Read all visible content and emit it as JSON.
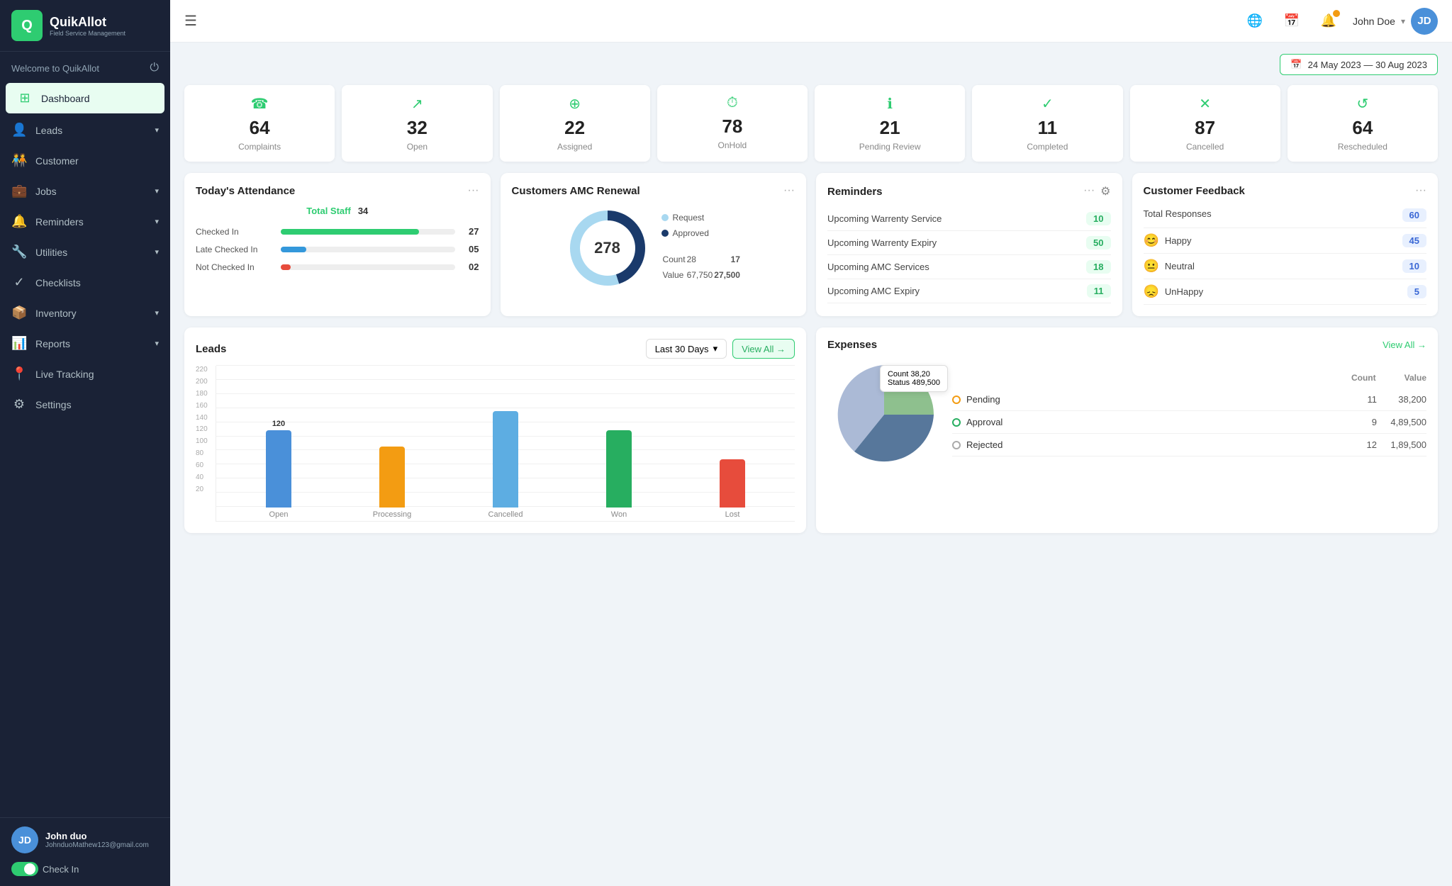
{
  "app": {
    "name": "QuikAllot",
    "tagline": "Field Service Management",
    "welcome": "Welcome to QuikAllot"
  },
  "topbar": {
    "menu_icon": "☰",
    "date_range": "24 May 2023 — 30 Aug 2023",
    "user_name": "John Doe"
  },
  "sidebar": {
    "items": [
      {
        "id": "dashboard",
        "label": "Dashboard",
        "icon": "⊞",
        "active": true
      },
      {
        "id": "leads",
        "label": "Leads",
        "icon": "👤",
        "has_arrow": true
      },
      {
        "id": "customer",
        "label": "Customer",
        "icon": "🧑‍🤝‍🧑",
        "has_arrow": false
      },
      {
        "id": "jobs",
        "label": "Jobs",
        "icon": "💼",
        "has_arrow": true
      },
      {
        "id": "reminders",
        "label": "Reminders",
        "icon": "🔔",
        "has_arrow": true
      },
      {
        "id": "utilities",
        "label": "Utilities",
        "icon": "🔧",
        "has_arrow": true
      },
      {
        "id": "checklists",
        "label": "Checklists",
        "icon": "✓",
        "has_arrow": false
      },
      {
        "id": "inventory",
        "label": "Inventory",
        "icon": "📦",
        "has_arrow": true
      },
      {
        "id": "reports",
        "label": "Reports",
        "icon": "📊",
        "has_arrow": true
      },
      {
        "id": "live-tracking",
        "label": "Live Tracking",
        "icon": "📍",
        "has_arrow": false
      },
      {
        "id": "settings",
        "label": "Settings",
        "icon": "⚙",
        "has_arrow": false
      }
    ],
    "user": {
      "name": "John duo",
      "email": "JohnduoMathew123@gmail.com",
      "check_in_label": "Check In"
    }
  },
  "stats": [
    {
      "id": "complaints",
      "icon": "☎",
      "number": "64",
      "label": "Complaints"
    },
    {
      "id": "open",
      "icon": "↗",
      "number": "32",
      "label": "Open"
    },
    {
      "id": "assigned",
      "icon": "⊕",
      "number": "22",
      "label": "Assigned"
    },
    {
      "id": "onhold",
      "icon": "⏱",
      "number": "78",
      "label": "OnHold"
    },
    {
      "id": "pending-review",
      "icon": "ℹ",
      "number": "21",
      "label": "Pending Review"
    },
    {
      "id": "completed",
      "icon": "✓",
      "number": "11",
      "label": "Completed"
    },
    {
      "id": "cancelled",
      "icon": "✕",
      "number": "87",
      "label": "Cancelled"
    },
    {
      "id": "rescheduled",
      "icon": "↺",
      "number": "64",
      "label": "Rescheduled"
    }
  ],
  "attendance": {
    "title": "Today's Attendance",
    "total_staff_label": "Total Staff",
    "total_staff": "34",
    "rows": [
      {
        "label": "Checked In",
        "value": 27,
        "max": 34,
        "display": "27",
        "color": "#2ecc71"
      },
      {
        "label": "Late Checked In",
        "value": 5,
        "max": 34,
        "display": "05",
        "color": "#3498db"
      },
      {
        "label": "Not Checked In",
        "value": 2,
        "max": 34,
        "display": "02",
        "color": "#e74c3c"
      }
    ]
  },
  "amc": {
    "title": "Customers AMC Renewal",
    "center_value": "278",
    "legend": [
      {
        "label": "Request",
        "color": "#a8d8f0"
      },
      {
        "label": "Approved",
        "color": "#1a3a6b"
      }
    ],
    "table": [
      {
        "label": "Count",
        "request": "28",
        "approved": "17"
      },
      {
        "label": "Value",
        "request": "67,750",
        "approved": "27,500"
      }
    ]
  },
  "reminders": {
    "title": "Reminders",
    "items": [
      {
        "label": "Upcoming Warrenty Service",
        "value": "10"
      },
      {
        "label": "Upcoming Warrenty Expiry",
        "value": "50"
      },
      {
        "label": "Upcoming AMC Services",
        "value": "18"
      },
      {
        "label": "Upcoming AMC Expiry",
        "value": "11"
      }
    ]
  },
  "feedback": {
    "title": "Customer Feedback",
    "total_responses_label": "Total Responses",
    "total_responses": "60",
    "items": [
      {
        "label": "Happy",
        "icon": "😊",
        "value": "45"
      },
      {
        "label": "Neutral",
        "icon": "😐",
        "value": "10"
      },
      {
        "label": "UnHappy",
        "icon": "😞",
        "value": "5"
      }
    ]
  },
  "leads_chart": {
    "title": "Leads",
    "filter_label": "Last 30 Days",
    "view_all_label": "View All →",
    "y_axis": [
      "20",
      "40",
      "60",
      "80",
      "100",
      "120",
      "140",
      "160",
      "180",
      "200",
      "220"
    ],
    "bars": [
      {
        "label": "Open",
        "value": 120,
        "color": "#4a90d9",
        "tooltip": "120"
      },
      {
        "label": "Processing",
        "value": 95,
        "color": "#f39c12",
        "tooltip": "95"
      },
      {
        "label": "Cancelled",
        "value": 150,
        "color": "#5dade2",
        "tooltip": "150"
      },
      {
        "label": "Won",
        "value": 120,
        "color": "#27ae60",
        "tooltip": "120"
      },
      {
        "label": "Lost",
        "value": 75,
        "color": "#e74c3c",
        "tooltip": "75"
      }
    ]
  },
  "expenses": {
    "title": "Expenses",
    "view_all_label": "View All →",
    "tooltip": {
      "count": "Count: 38,20",
      "status": "Status: 489,500"
    },
    "col_count": "Count",
    "col_value": "Value",
    "items": [
      {
        "label": "Pending",
        "color": "#f39c12",
        "dot_style": "border: 2px solid #f39c12; background: transparent;",
        "count": "11",
        "value": "38,200"
      },
      {
        "label": "Approval",
        "color": "#27ae60",
        "dot_style": "border: 2px solid #27ae60; background: transparent;",
        "count": "9",
        "value": "4,89,500"
      },
      {
        "label": "Rejected",
        "color": "#aaa",
        "dot_style": "border: 2px solid #aaa; background: transparent;",
        "count": "12",
        "value": "1,89,500"
      }
    ],
    "pie": {
      "segments": [
        {
          "color": "#6b8fb5",
          "percent": 30
        },
        {
          "color": "#3a5f8a",
          "percent": 45
        },
        {
          "color": "#7ab57a",
          "percent": 25
        }
      ]
    }
  }
}
